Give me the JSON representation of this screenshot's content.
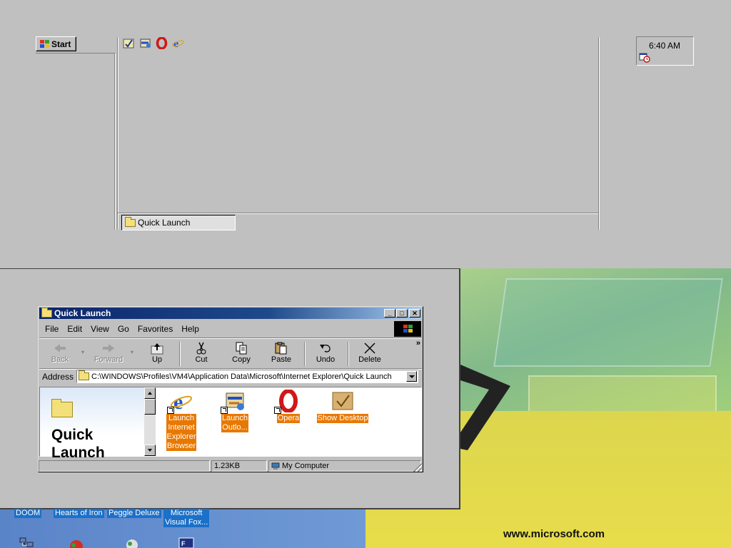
{
  "taskbar": {
    "start_label": "Start",
    "quicklaunch_icons": [
      "show-desktop-icon",
      "outlook-icon",
      "opera-icon",
      "internet-explorer-icon"
    ],
    "task_button_label": "Quick Launch",
    "clock": "6:40 AM"
  },
  "explorer": {
    "title": "Quick Launch",
    "menu": [
      "File",
      "Edit",
      "View",
      "Go",
      "Favorites",
      "Help"
    ],
    "toolbar": {
      "back": "Back",
      "forward": "Forward",
      "up": "Up",
      "cut": "Cut",
      "copy": "Copy",
      "paste": "Paste",
      "undo": "Undo",
      "delete": "Delete"
    },
    "address_label": "Address",
    "address_value": "C:\\WINDOWS\\Profiles\\VM4\\Application Data\\Microsoft\\Internet Explorer\\Quick Launch",
    "webview_title_line1": "Quick",
    "webview_title_line2": "Launch",
    "files": [
      {
        "label_lines": [
          "Launch",
          "Internet",
          "Explorer",
          "Browser"
        ],
        "icon": "internet-explorer-icon"
      },
      {
        "label_lines": [
          "Launch",
          "Outlo..."
        ],
        "icon": "outlook-express-icon"
      },
      {
        "label_lines": [
          "Opera"
        ],
        "icon": "opera-icon"
      },
      {
        "label_lines": [
          "Show Desktop"
        ],
        "icon": "show-desktop-icon"
      }
    ],
    "status": {
      "size": "1.23KB",
      "zone": "My Computer"
    }
  },
  "desktop": {
    "icons": [
      {
        "label": "DOOM"
      },
      {
        "label": "Hearts of Iron"
      },
      {
        "label": "Peggle Deluxe"
      },
      {
        "label_lines": [
          "Microsoft",
          "Visual Fox..."
        ]
      }
    ],
    "wallpaper_text": "www.microsoft.com"
  },
  "colors": {
    "titlebar_start": "#0a246a",
    "titlebar_end": "#a6caf0",
    "selection": "#e87800",
    "desktop_label_bg": "#1b70c8"
  }
}
